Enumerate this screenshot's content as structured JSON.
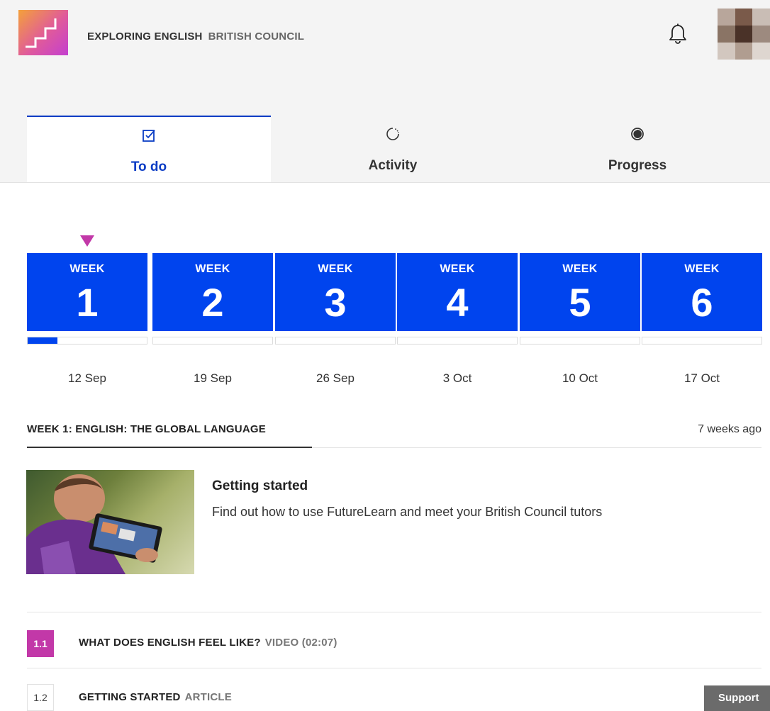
{
  "header": {
    "course_title": "EXPLORING ENGLISH",
    "course_org": "BRITISH COUNCIL",
    "colors": {
      "header_bg": "#f4f4f4",
      "accent": "#0a3cc4"
    }
  },
  "tabs": [
    {
      "label": "To do",
      "icon": "checkbox-icon",
      "active": true
    },
    {
      "label": "Activity",
      "icon": "activity-spinner-icon",
      "active": false
    },
    {
      "label": "Progress",
      "icon": "progress-circle-icon",
      "active": false
    }
  ],
  "weeks": [
    {
      "word": "WEEK",
      "number": "1",
      "date": "12 Sep",
      "progress": 0.25,
      "current": true
    },
    {
      "word": "WEEK",
      "number": "2",
      "date": "19 Sep",
      "progress": 0
    },
    {
      "word": "WEEK",
      "number": "3",
      "date": "26 Sep",
      "progress": 0
    },
    {
      "word": "WEEK",
      "number": "4",
      "date": "3 Oct",
      "progress": 0
    },
    {
      "word": "WEEK",
      "number": "5",
      "date": "10 Oct",
      "progress": 0
    },
    {
      "word": "WEEK",
      "number": "6",
      "date": "17 Oct",
      "progress": 0
    }
  ],
  "week_colors": {
    "tile": "#0044ee",
    "marker": "#c238a8"
  },
  "section": {
    "title": "WEEK 1: ENGLISH: THE GLOBAL LANGUAGE",
    "time_ago": "7 weeks ago"
  },
  "intro": {
    "title": "Getting started",
    "description": "Find out how to use FutureLearn and meet your British Council tutors"
  },
  "steps": [
    {
      "number": "1.1",
      "title": "WHAT DOES ENGLISH FEEL LIKE?",
      "type": "VIDEO (02:07)",
      "current": true
    },
    {
      "number": "1.2",
      "title": "GETTING STARTED",
      "type": "ARTICLE",
      "current": false
    }
  ],
  "support": {
    "label": "Support"
  }
}
